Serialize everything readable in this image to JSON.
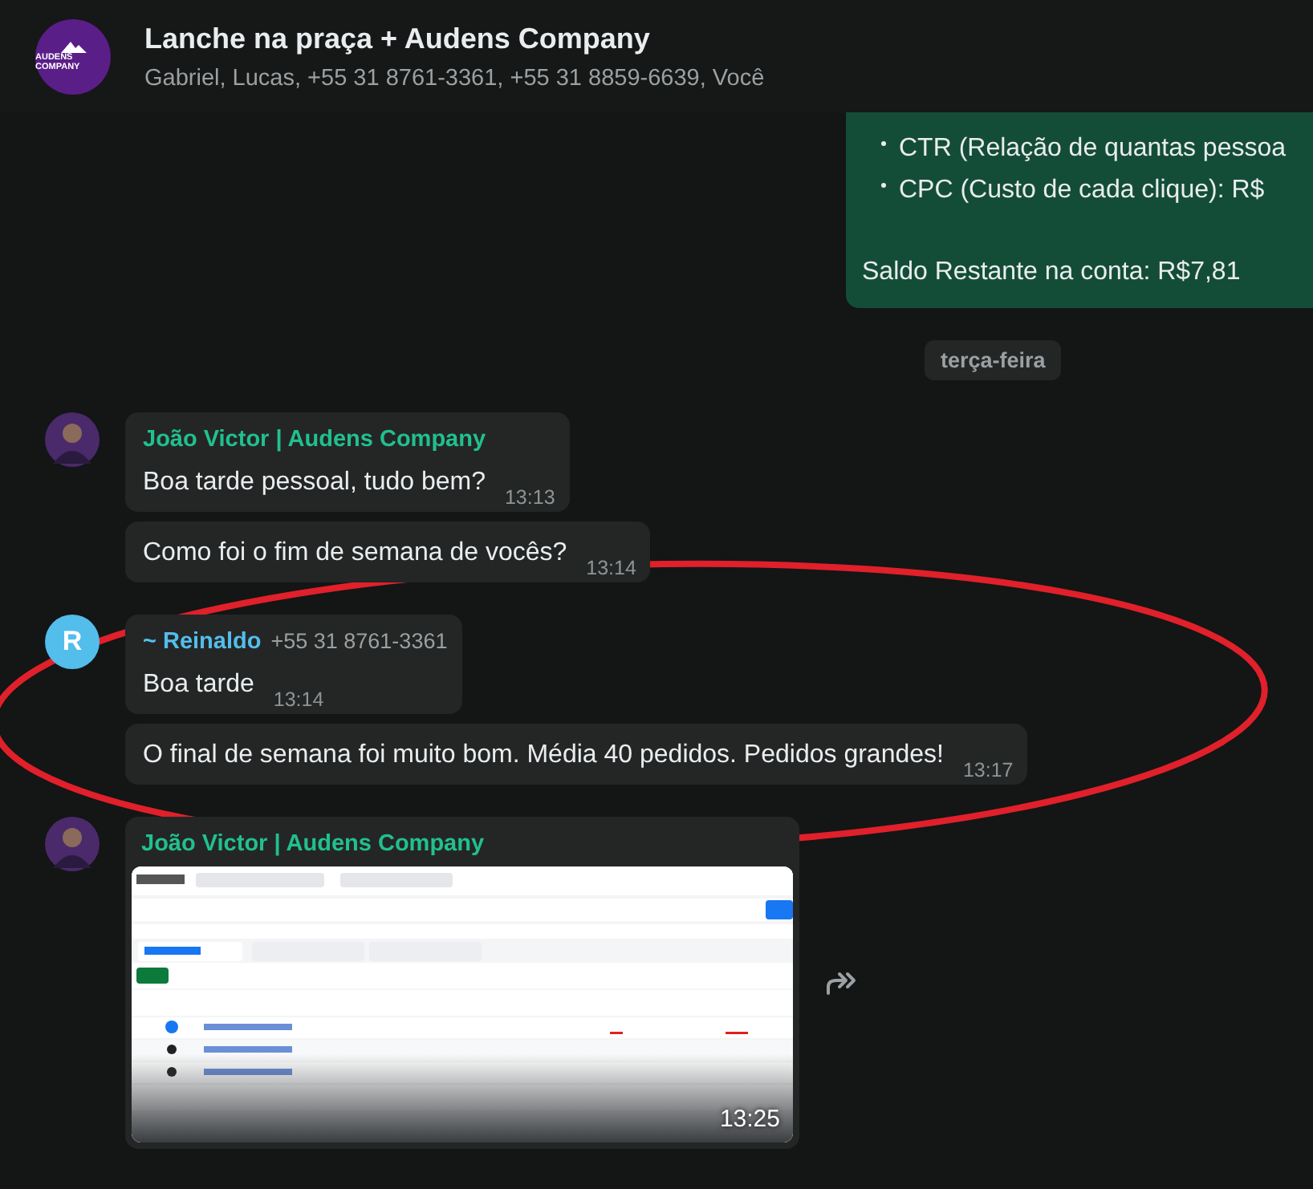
{
  "header": {
    "logo_text": "AUDENS COMPANY",
    "title": "Lanche na praça + Audens Company",
    "participants": "Gabriel, Lucas, +55 31 8761-3361, +55 31 8859-6639, Você"
  },
  "feed": [
    {
      "kind": "outgoing",
      "bullets": [
        "CTR (Relação de quantas pessoa",
        "CPC (Custo de cada clique): R$"
      ],
      "text": "Saldo Restante na conta: R$7,81"
    },
    {
      "kind": "date",
      "text": "terça-feira"
    },
    {
      "kind": "group",
      "sender": "João Victor | Audens Company",
      "color": "#21c08e",
      "avatar": {
        "kind": "photo"
      },
      "messages": [
        {
          "kind": "text",
          "text": "Boa tarde pessoal, tudo bem?",
          "time": "13:13"
        },
        {
          "kind": "text",
          "text": "Como foi o fim de semana de vocês?",
          "time": "13:14"
        }
      ]
    },
    {
      "kind": "group",
      "sender": "~ Reinaldo",
      "phone": "+55 31 8761-3361",
      "color": "#53bdeb",
      "avatar": {
        "kind": "letter",
        "letter": "R"
      },
      "messages": [
        {
          "kind": "text",
          "text": "Boa tarde",
          "time": "13:14"
        },
        {
          "kind": "text",
          "text": "O final de semana foi muito bom. Média 40 pedidos. Pedidos grandes!",
          "time": "13:17"
        }
      ]
    },
    {
      "kind": "group",
      "sender": "João Victor | Audens Company",
      "color": "#21c08e",
      "avatar": {
        "kind": "photo"
      },
      "messages": [
        {
          "kind": "image",
          "time": "13:25",
          "forward": true
        }
      ]
    }
  ],
  "annotation": {
    "kind": "ellipse",
    "color": "#e0202a"
  }
}
